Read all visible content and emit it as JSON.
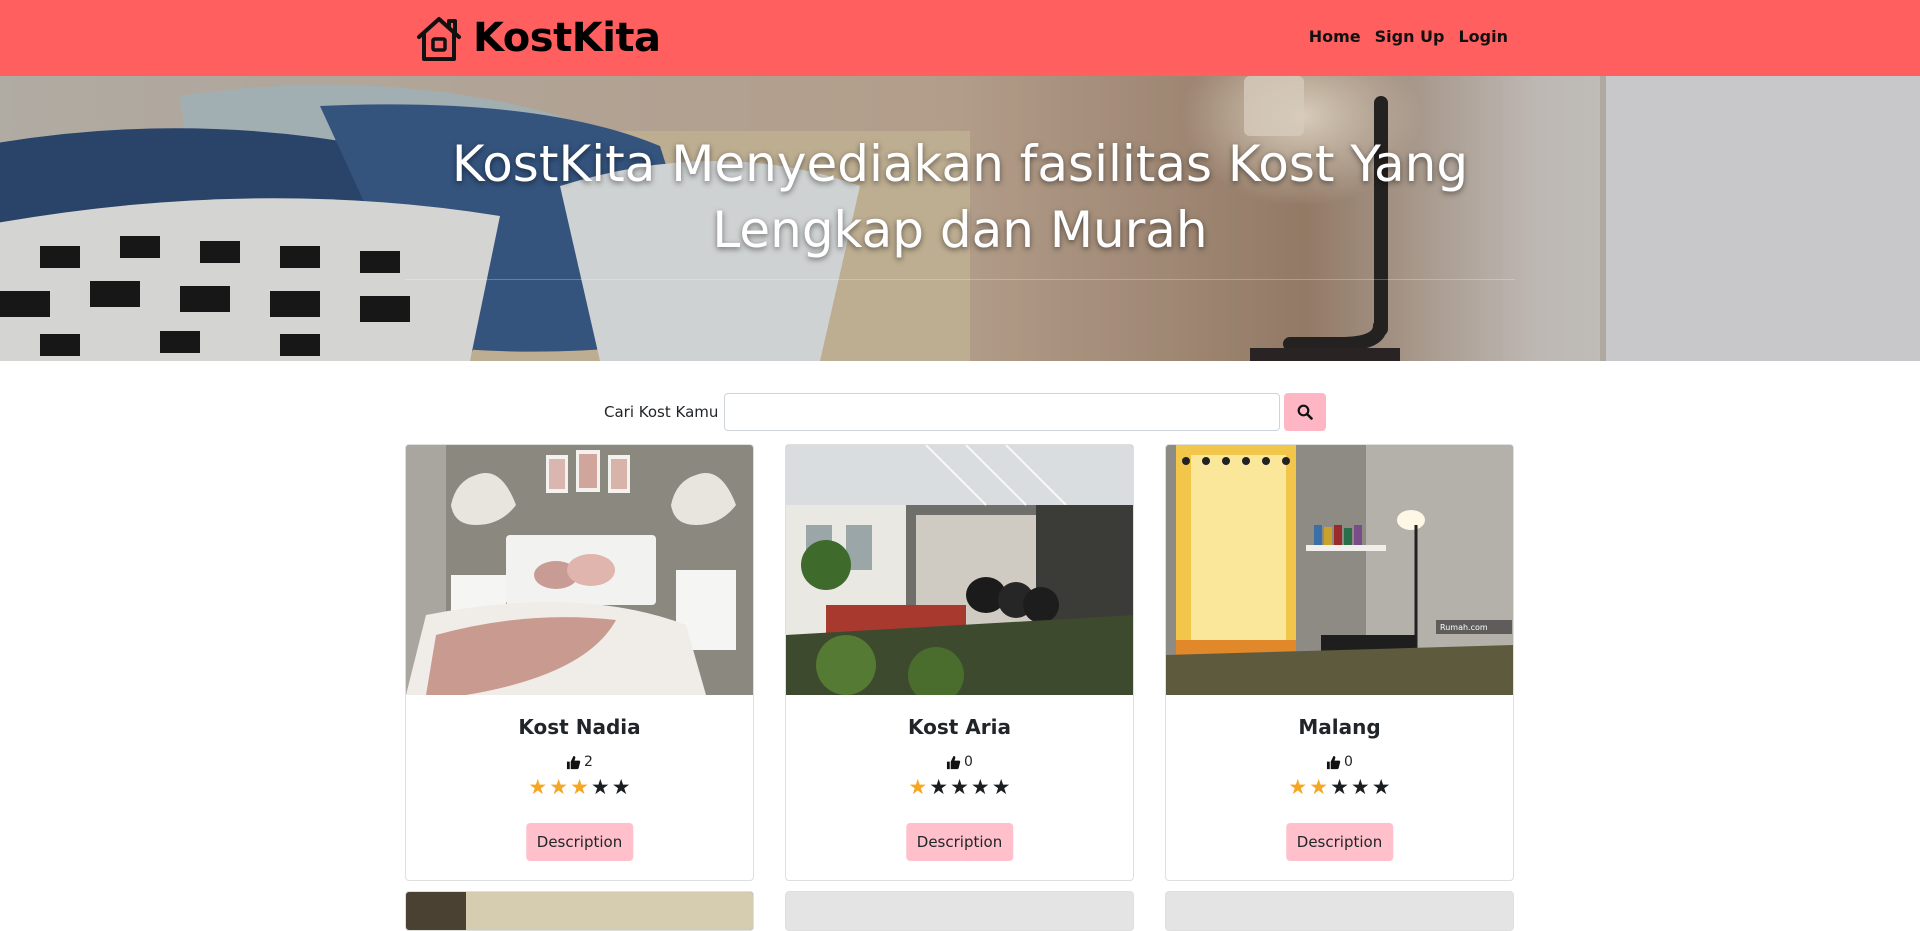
{
  "brand": {
    "name": "KostKita",
    "icon": "house-icon"
  },
  "nav": {
    "home": "Home",
    "signup": "Sign Up",
    "login": "Login"
  },
  "hero": {
    "title": "KostKita Menyediakan fasilitas Kost Yang Lengkap dan Murah"
  },
  "search": {
    "label": "Cari Kost Kamu",
    "value": "",
    "placeholder": "",
    "button_icon": "search-icon"
  },
  "cards": [
    {
      "title": "Kost Nadia",
      "likes": "2",
      "rating": 3,
      "button": "Description",
      "image": "bedroom-photo"
    },
    {
      "title": "Kost Aria",
      "likes": "0",
      "rating": 1,
      "button": "Description",
      "image": "courtyard-photo"
    },
    {
      "title": "Malang",
      "likes": "0",
      "rating": 2,
      "button": "Description",
      "image": "room-curtain-photo",
      "image_watermark": "Rumah.com"
    }
  ],
  "colors": {
    "navbar": "#ff5f5f",
    "button": "#ffc0cb",
    "search_button": "#ffb6c4",
    "star_on": "#f5a623",
    "star_off": "#1b1e21"
  }
}
